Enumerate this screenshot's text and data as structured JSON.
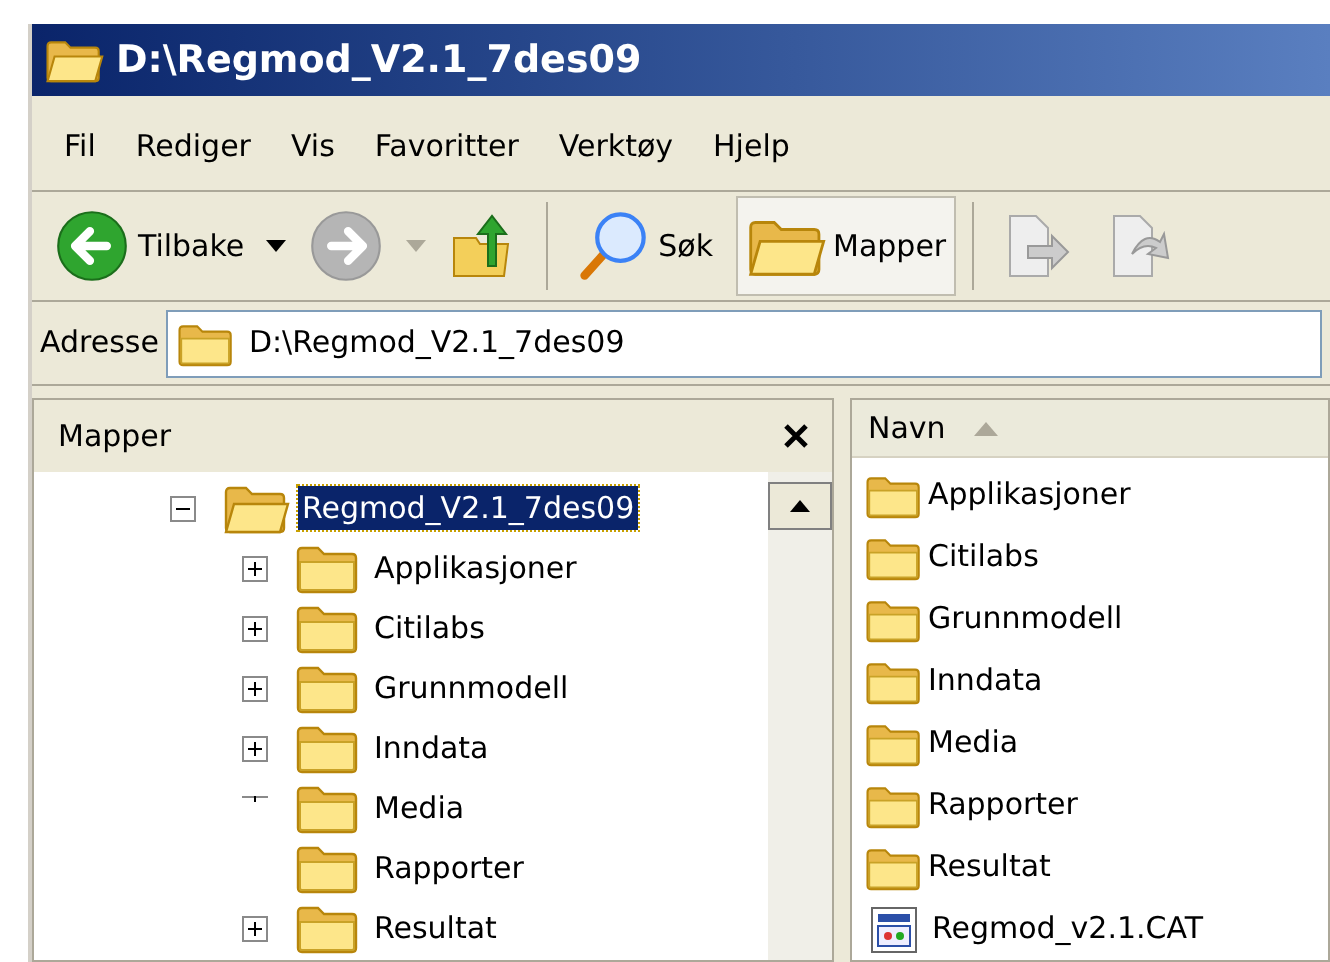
{
  "window": {
    "title": "D:\\Regmod_V2.1_7des09"
  },
  "menu": [
    "Fil",
    "Rediger",
    "Vis",
    "Favoritter",
    "Verktøy",
    "Hjelp"
  ],
  "toolbar": [
    {
      "kind": "back",
      "label": "Tilbake",
      "disabled": false,
      "selected": false
    },
    {
      "kind": "forward",
      "disabled": true,
      "selected": false
    },
    {
      "kind": "up",
      "disabled": false,
      "selected": false
    },
    {
      "kind": "search",
      "label": "Søk",
      "disabled": false,
      "selected": false
    },
    {
      "kind": "folders",
      "label": "Mapper",
      "disabled": false,
      "selected": true
    },
    {
      "kind": "move",
      "disabled": true,
      "selected": false
    },
    {
      "kind": "copy",
      "disabled": true,
      "selected": false
    }
  ],
  "address": {
    "label": "Adresse",
    "value": "D:\\Regmod_V2.1_7des09"
  },
  "folders_pane": {
    "title": "Mapper",
    "tree": [
      {
        "label": "Regmod_V2.1_7des09",
        "kind": "expanded",
        "selected": true,
        "children": [
          {
            "label": "Applikasjoner",
            "kind": "collapsed",
            "selected": false
          },
          {
            "label": "Citilabs",
            "kind": "collapsed",
            "selected": false
          },
          {
            "label": "Grunnmodell",
            "kind": "collapsed",
            "selected": false
          },
          {
            "label": "Inndata",
            "kind": "collapsed",
            "selected": false
          },
          {
            "label": "Media",
            "kind": "glitched",
            "selected": false
          },
          {
            "label": "Rapporter",
            "kind": "leaf",
            "selected": false
          },
          {
            "label": "Resultat",
            "kind": "collapsed",
            "selected": false
          }
        ]
      }
    ]
  },
  "file_list": {
    "column": "Navn",
    "items": [
      {
        "name": "Applikasjoner",
        "kind": "folder"
      },
      {
        "name": "Citilabs",
        "kind": "folder"
      },
      {
        "name": "Grunnmodell",
        "kind": "folder"
      },
      {
        "name": "Inndata",
        "kind": "folder"
      },
      {
        "name": "Media",
        "kind": "folder"
      },
      {
        "name": "Rapporter",
        "kind": "folder"
      },
      {
        "name": "Resultat",
        "kind": "folder"
      },
      {
        "name": "Regmod_v2.1.CAT",
        "kind": "file"
      }
    ]
  }
}
